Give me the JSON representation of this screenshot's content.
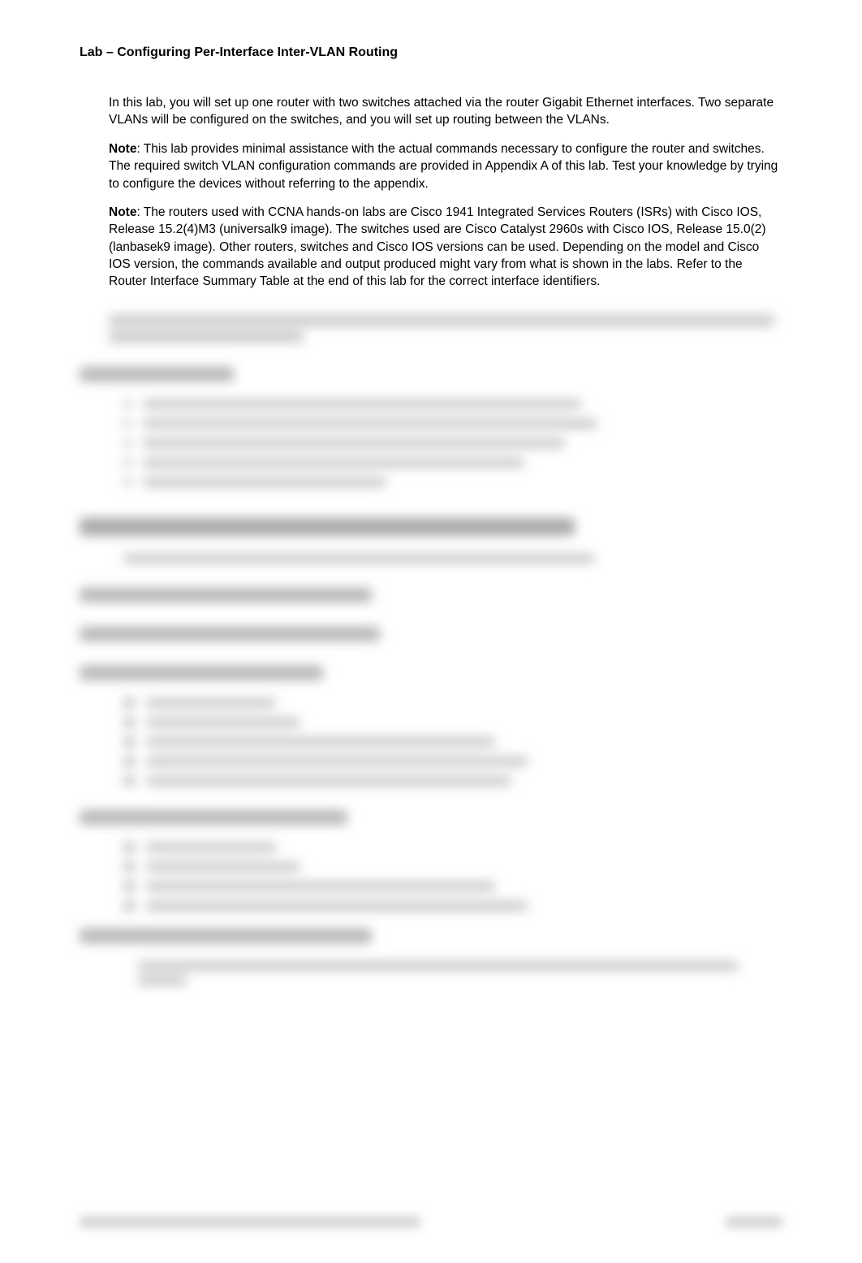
{
  "header": {
    "title": "Lab – Configuring Per-Interface Inter-VLAN Routing"
  },
  "visible": {
    "p1": "In this lab, you will set up one router with two switches attached via the router Gigabit Ethernet interfaces. Two separate VLANs will be configured on the switches, and you will set up routing between the VLANs.",
    "p2_label": "Note",
    "p2": ": This lab provides minimal assistance with the actual commands necessary to configure the router and switches. The required switch VLAN configuration commands are provided in Appendix A of this lab. Test your knowledge by trying to configure the devices without referring to the appendix.",
    "p3_label": "Note",
    "p3": ": The routers used with CCNA hands-on labs are Cisco 1941 Integrated Services Routers (ISRs) with Cisco IOS, Release 15.2(4)M3 (universalk9 image). The switches used are Cisco Catalyst 2960s with Cisco IOS, Release 15.0(2) (lanbasek9 image). Other routers, switches and Cisco IOS versions can be used. Depending on the model and Cisco IOS version, the commands available and output produced might vary from what is shown in the labs. Refer to the Router Interface Summary Table at the end of this lab for the correct interface identifiers."
  }
}
